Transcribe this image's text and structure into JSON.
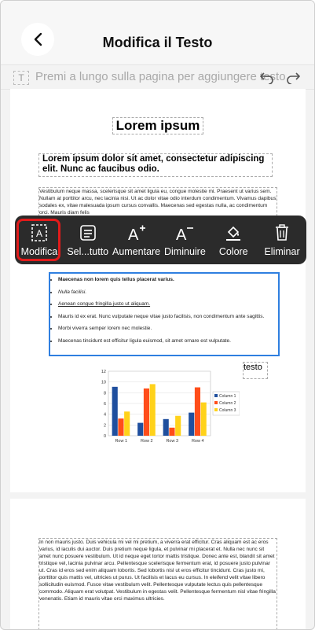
{
  "header": {
    "title": "Modifica il Testo"
  },
  "hint": {
    "text": "Premi a lungo sulla pagina per aggiungere testo"
  },
  "doc": {
    "title": "Lorem ipsum",
    "subtitle": "Lorem ipsum dolor sit amet, consectetur adipiscing elit. Nunc ac faucibus odio.",
    "para1": "Vestibulum neque massa, scelerisque sit amet ligula eu, congue molestie mi. Praesent ut varius sem. Nullam at porttitor arcu, nec lacinia nisi. Ut ac dolor vitae odio interdum condimentum. Vivamus dapibus sodales ex, vitae malesuada ipsum cursus convallis. Maecenas sed egestas nulla, ac condimentum orci. Mauris diam felis",
    "list": [
      "Maecenas non lorem quis tellus placerat varius.",
      "Nulla facilisi.",
      "Aenean congue fringilla justo ut aliquam.",
      "Mauris id ex erat. Nunc vulputate neque vitae justo facilisis, non condimentum ante sagittis.",
      "Morbi viverra semper lorem nec molestie.",
      "Maecenas tincidunt est efficitur ligula euismod, sit amet ornare est vulputate."
    ],
    "testo": "testo",
    "para2": "In non mauris justo. Duis vehicula mi vel mi pretium, a viverra erat efficitur. Cras aliquam est ac eros varius, id iaculis dui auctor. Duis pretium neque ligula, et pulvinar mi placerat et. Nulla nec nunc sit amet nunc posuere vestibulum. Ut id neque eget tortor mattis tristique. Donec ante est, blandit sit amet tristique vel, lacinia pulvinar arcu. Pellentesque scelerisque fermentum erat, id posuere justo pulvinar ut. Cras id eros sed enim aliquam lobortis. Sed lobortis nisl ut eros efficitur tincidunt. Cras justo mi, porttitor quis mattis vel, ultricies ut purus. Ut facilisis et lacus eu cursus. In eleifend velit vitae libero sollicitudin euismod. Fusce vitae vestibulum velit. Pellentesque vulputate lectus quis pellentesque commodo. Aliquam erat volutpat. Vestibulum in egestas velit. Pellentesque fermentum nisl vitae fringilla venenatis. Etiam id mauris vitae orci maximus ultricies."
  },
  "toolbar": {
    "items": [
      {
        "label": "Modifica",
        "icon": "edit-text-icon",
        "selected": true
      },
      {
        "label": "Sel...tutto",
        "icon": "select-all-icon"
      },
      {
        "label": "Aumentare",
        "icon": "font-increase-icon"
      },
      {
        "label": "Diminuire",
        "icon": "font-decrease-icon"
      },
      {
        "label": "Colore",
        "icon": "fill-color-icon"
      },
      {
        "label": "Eliminar",
        "icon": "trash-icon"
      }
    ]
  },
  "chart_data": {
    "type": "bar",
    "categories": [
      "Row 1",
      "Row 2",
      "Row 3",
      "Row 4"
    ],
    "series": [
      {
        "name": "Column 1",
        "values": [
          9.1,
          2.4,
          3.1,
          4.3
        ],
        "color": "#1f4f9e"
      },
      {
        "name": "Column 2",
        "values": [
          3.2,
          8.8,
          1.5,
          9.0
        ],
        "color": "#ff4d1a"
      },
      {
        "name": "Column 3",
        "values": [
          4.5,
          9.6,
          3.7,
          6.2
        ],
        "color": "#ffd21a"
      }
    ],
    "ylim": [
      0,
      12
    ],
    "yticks": [
      0,
      2,
      4,
      6,
      8,
      10,
      12
    ],
    "legend": "right"
  },
  "colors": {
    "toolbar_bg": "#2b2b2b",
    "selected_outline": "#e21b1b",
    "selection_box": "#2f7fe0"
  }
}
